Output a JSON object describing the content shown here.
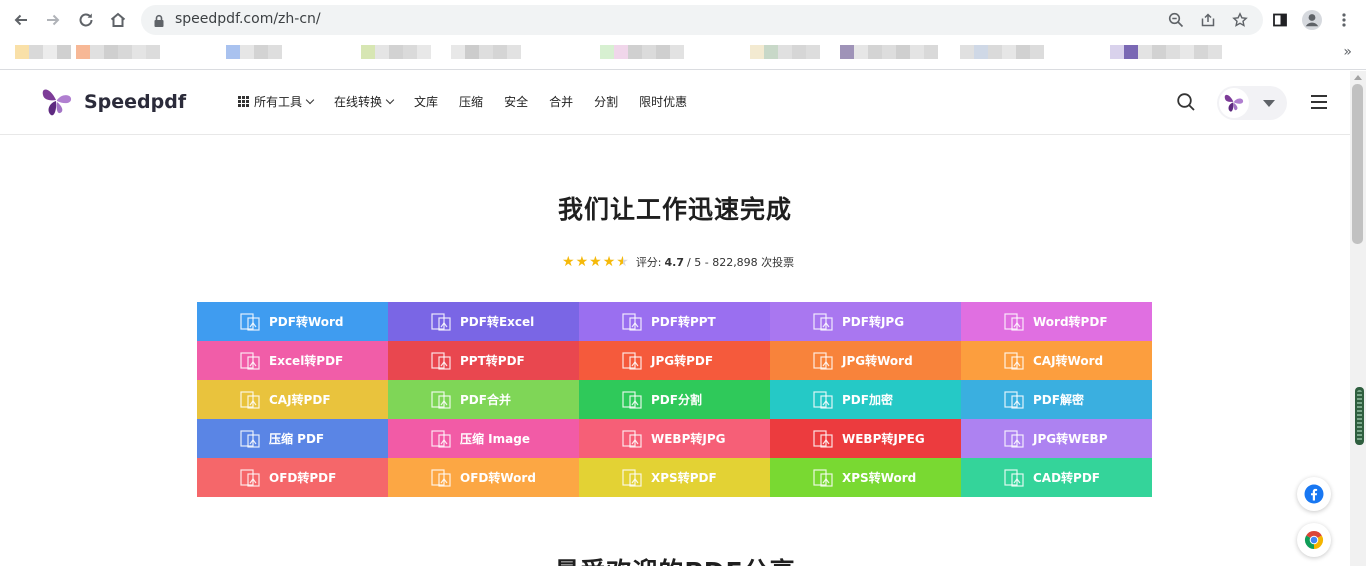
{
  "browser": {
    "url": "speedpdf.com/zh-cn/",
    "bookmarks": [
      [
        "#f9e0a8",
        "#d9d9d9",
        "#ececec",
        "#d0d0d0"
      ],
      [
        "#f7b896",
        "#e0e0e0",
        "#cfcfcf",
        "#d8d8d8",
        "#e4e4e4",
        "#dcdcdc"
      ],
      [
        "#a9c2ef",
        "#e6e6e6",
        "#d3d3d3",
        "#dedede"
      ],
      [
        "#d7e6b3",
        "#e5e5e5",
        "#d2d2d2",
        "#dadada",
        "#e8e8e8"
      ],
      [
        "#e8e8e8",
        "#cccccc",
        "#dedede",
        "#d5d5d5",
        "#e2e2e2"
      ],
      [
        "#d7f0d1",
        "#f0d6ea",
        "#d0d0d0",
        "#dbdbdb",
        "#cfcfcf",
        "#e2e2e2"
      ],
      [
        "#f3ead1",
        "#c8d8c8",
        "#e0e0e0",
        "#d6d6d6",
        "#dddddd"
      ],
      [
        "#9f93b8",
        "#e6e6e6",
        "#d4d4d4",
        "#dddddd",
        "#cfcfcf",
        "#e4e4e4",
        "#d9d9d9"
      ],
      [
        "#e0e0e0",
        "#cfd8e6",
        "#dadada",
        "#e6e6e6",
        "#d1d1d1",
        "#dcdcdc"
      ],
      [
        "#d9d2ec",
        "#7a68b4",
        "#e3e3e3",
        "#d2d2d2",
        "#dedede",
        "#e8e8e8",
        "#d6d6d6",
        "#e1e1e1"
      ]
    ]
  },
  "header": {
    "brand": "Speedpdf",
    "nav": [
      {
        "label": "所有工具",
        "grid_icon": true,
        "caret": true
      },
      {
        "label": "在线转换",
        "grid_icon": false,
        "caret": true
      },
      {
        "label": "文库",
        "grid_icon": false,
        "caret": false
      },
      {
        "label": "压缩",
        "grid_icon": false,
        "caret": false
      },
      {
        "label": "安全",
        "grid_icon": false,
        "caret": false
      },
      {
        "label": "合并",
        "grid_icon": false,
        "caret": false
      },
      {
        "label": "分割",
        "grid_icon": false,
        "caret": false
      },
      {
        "label": "限时优惠",
        "grid_icon": false,
        "caret": false
      }
    ]
  },
  "hero": {
    "title": "我们让工作迅速完成",
    "rating_prefix": "评分:",
    "rating_value": "4.7",
    "rating_rest": "/ 5 - 822,898 次投票",
    "stars": 4.7
  },
  "tools": [
    {
      "label": "PDF转Word",
      "color": "#3f9cf0"
    },
    {
      "label": "PDF转Excel",
      "color": "#7a66e5"
    },
    {
      "label": "PDF转PPT",
      "color": "#9a6ff0"
    },
    {
      "label": "PDF转JPG",
      "color": "#a977f0"
    },
    {
      "label": "Word转PDF",
      "color": "#e06fe1"
    },
    {
      "label": "Excel转PDF",
      "color": "#f15da8"
    },
    {
      "label": "PPT转PDF",
      "color": "#e9474f"
    },
    {
      "label": "JPG转PDF",
      "color": "#f55a3c"
    },
    {
      "label": "JPG转Word",
      "color": "#f8833b"
    },
    {
      "label": "CAJ转Word",
      "color": "#fc9e3e"
    },
    {
      "label": "CAJ转PDF",
      "color": "#e9c33d"
    },
    {
      "label": "PDF合并",
      "color": "#7fd657"
    },
    {
      "label": "PDF分割",
      "color": "#2fc95a"
    },
    {
      "label": "PDF加密",
      "color": "#25c9c6"
    },
    {
      "label": "PDF解密",
      "color": "#3aafe0"
    },
    {
      "label": "压缩 PDF",
      "color": "#5a85e5"
    },
    {
      "label": "压缩 Image",
      "color": "#f25ba6"
    },
    {
      "label": "WEBP转JPG",
      "color": "#f65f77"
    },
    {
      "label": "WEBP转JPEG",
      "color": "#ec3b3e"
    },
    {
      "label": "JPG转WEBP",
      "color": "#ad82f1"
    },
    {
      "label": "OFD转PDF",
      "color": "#f5676a"
    },
    {
      "label": "OFD转Word",
      "color": "#fca744"
    },
    {
      "label": "XPS转PDF",
      "color": "#e3d234"
    },
    {
      "label": "XPS转Word",
      "color": "#79d932"
    },
    {
      "label": "CAD转PDF",
      "color": "#34d49a"
    }
  ],
  "next_section": {
    "title": "最受欢迎的PDF分享"
  }
}
